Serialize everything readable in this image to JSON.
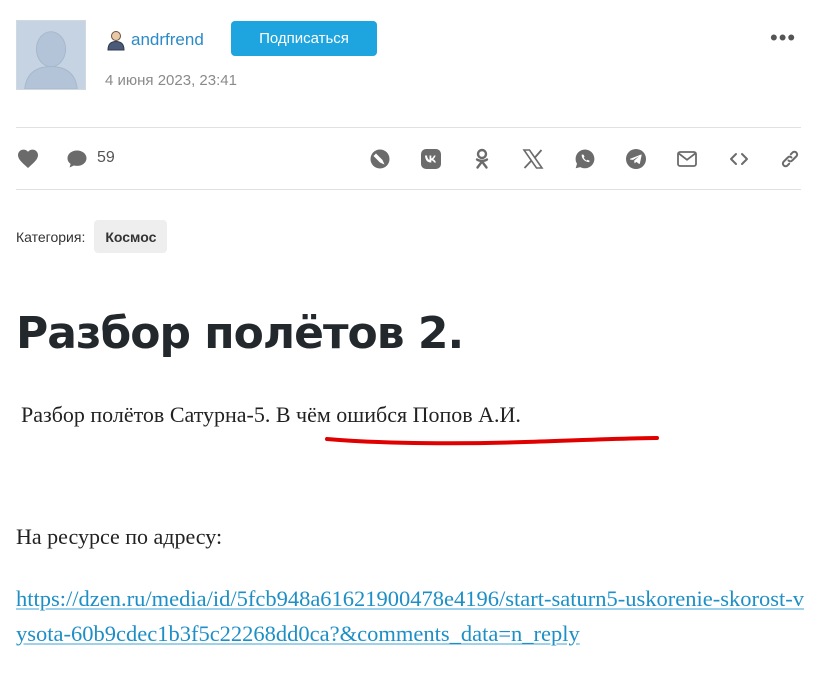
{
  "author": {
    "name": "andrfrend",
    "follow_label": "Подписаться",
    "date": "4 июня 2023, 23:41",
    "more_label": "•••"
  },
  "actions": {
    "comments_count": "59",
    "icons": [
      "heart-icon",
      "comment-icon",
      "livejournal-icon",
      "vk-icon",
      "odnoklassniki-icon",
      "x-icon",
      "whatsapp-icon",
      "telegram-icon",
      "mail-icon",
      "embed-icon",
      "link-icon"
    ]
  },
  "category": {
    "label": "Категория:",
    "value": "Космос"
  },
  "article": {
    "title": "Разбор полётов 2.",
    "subtitle": "Разбор полётов Сатурна-5. В чём ошибся Попов А.И.",
    "paragraph": "На ресурсе по адресу:",
    "link": "https://dzen.ru/media/id/5fcb948a61621900478e4196/start-saturn5-uskorenie-skorost-vysota-60b9cdec1b3f5c22268dd0ca?&comments_data=n_reply"
  },
  "colors": {
    "accent": "#1ea5df",
    "username": "#2b8ac7",
    "link": "#1d8fc6",
    "annotation": "#e00000"
  }
}
